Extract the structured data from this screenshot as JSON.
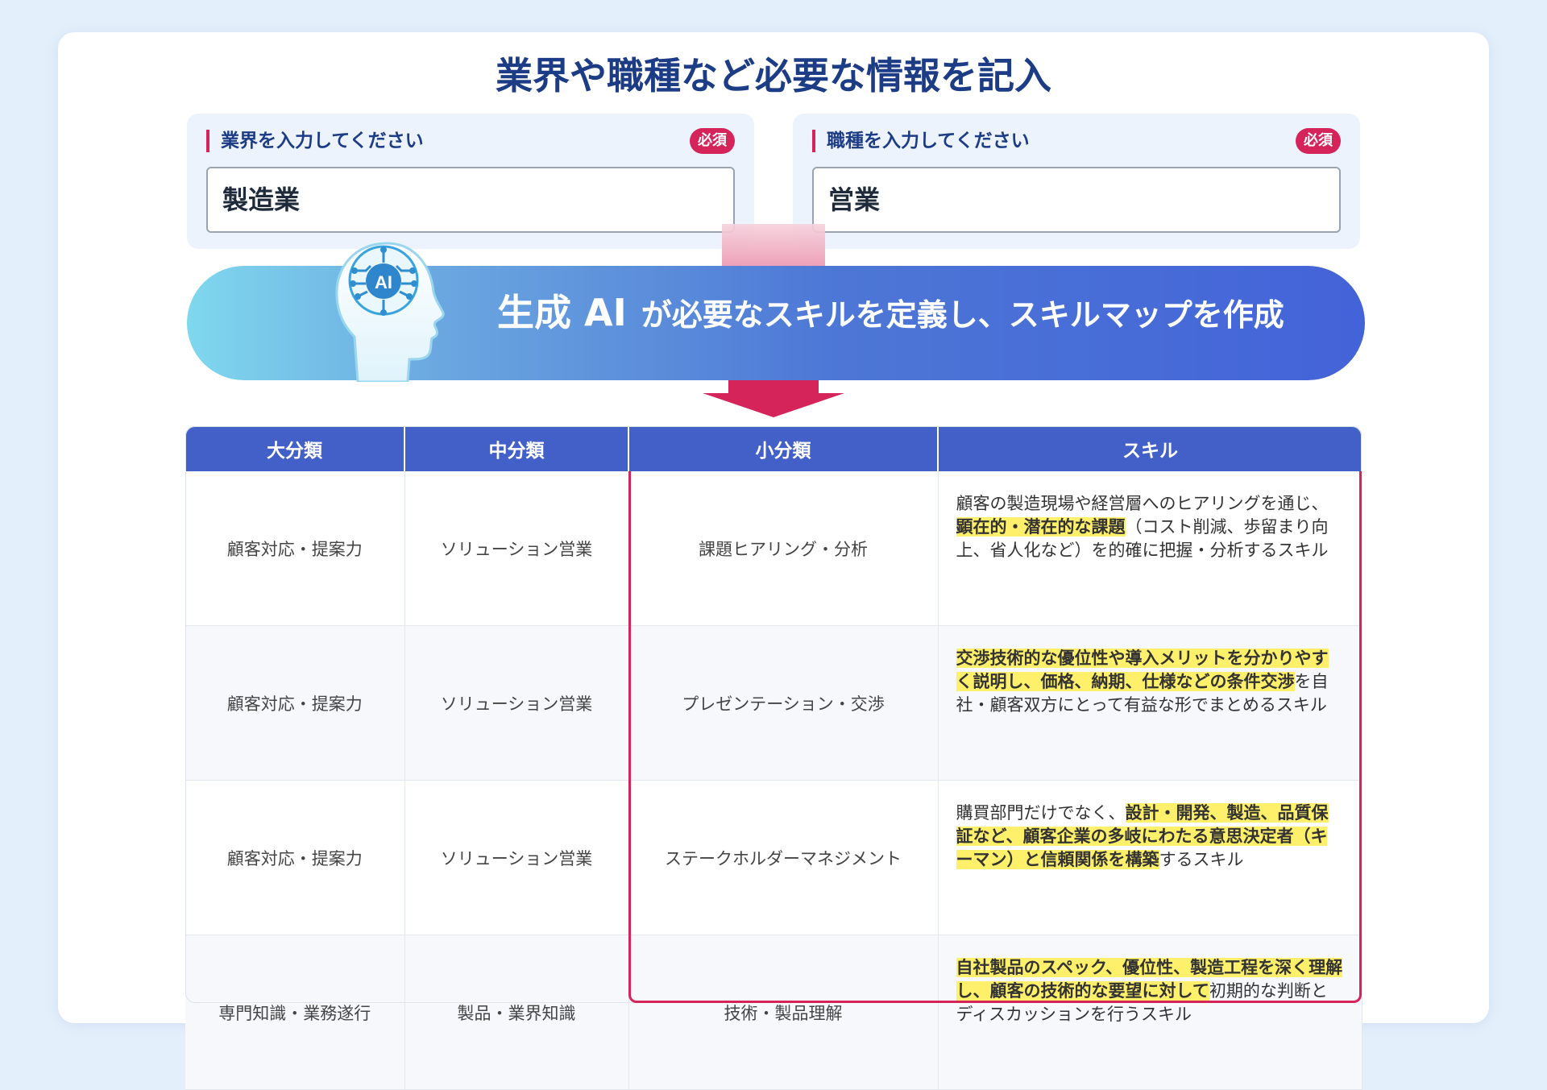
{
  "title": "業界や職種など必要な情報を記入",
  "industry_field": {
    "label": "業界を入力してください",
    "badge": "必須",
    "value": "製造業"
  },
  "job_field": {
    "label": "職種を入力してください",
    "badge": "必須",
    "value": "営業"
  },
  "banner": {
    "icon_text": "AI",
    "emphasis": "生成 AI",
    "text": "が必要なスキルを定義し、スキルマップを作成"
  },
  "colors": {
    "title": "#1d3c86",
    "accent": "#d4245a",
    "table_header": "#4260c7",
    "highlight": "#fff06b",
    "background": "#e3effb"
  },
  "table": {
    "headers": [
      "大分類",
      "中分類",
      "小分類",
      "スキル"
    ],
    "rows": [
      {
        "major": "顧客対応・提案力",
        "middle": "ソリューション営業",
        "minor": "課題ヒアリング・分析",
        "skill": {
          "pre": "顧客の製造現場や経営層へのヒアリングを通じ、",
          "highlight": "顕在的・潜在的な課題",
          "post": "（コスト削減、歩留まり向上、省人化など）を的確に把握・分析するスキル"
        }
      },
      {
        "major": "顧客対応・提案力",
        "middle": "ソリューション営業",
        "minor": "プレゼンテーション・交渉",
        "skill": {
          "pre": "",
          "highlight": "交渉技術的な優位性や導入メリットを分かりやすく説明し、価格、納期、仕様などの条件交渉",
          "post": "を自社・顧客双方にとって有益な形でまとめるスキル"
        }
      },
      {
        "major": "顧客対応・提案力",
        "middle": "ソリューション営業",
        "minor": "ステークホルダーマネジメント",
        "skill": {
          "pre": "購買部門だけでなく、",
          "highlight": "設計・開発、製造、品質保証など、顧客企業の多岐にわたる意思決定者（キーマン）と信頼関係を構築",
          "post": "するスキル"
        }
      },
      {
        "major": "専門知識・業務遂行",
        "middle": "製品・業界知識",
        "minor": "技術・製品理解",
        "skill": {
          "pre": "",
          "highlight": "自社製品のスペック、優位性、製造工程を深く理解し、顧客の技術的な要望に対して",
          "post": "初期的な判断とディスカッションを行うスキル"
        }
      }
    ]
  }
}
